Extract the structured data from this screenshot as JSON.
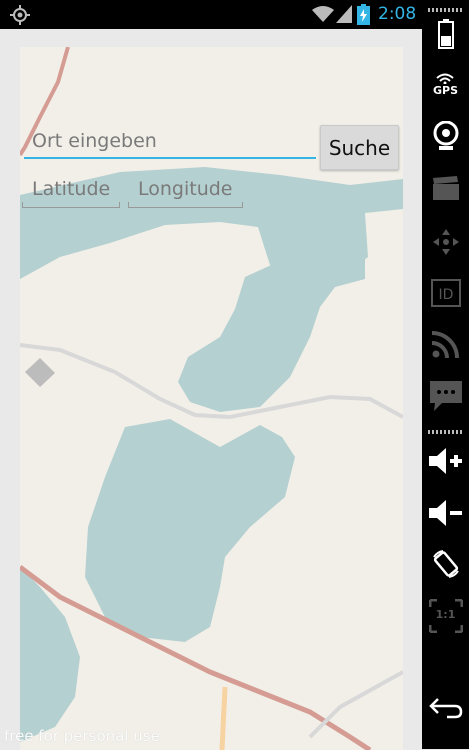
{
  "status_bar": {
    "time": "2:08",
    "icons": [
      "gps-icon",
      "wifi-icon",
      "signal-icon",
      "battery-icon"
    ],
    "time_color": "#33b5e5"
  },
  "search": {
    "placeholder": "Ort eingeben",
    "value": "",
    "button_label": "Suche"
  },
  "coordinates": {
    "latitude_placeholder": "Latitude",
    "longitude_placeholder": "Longitude"
  },
  "map": {
    "water_color": "#b5d0d0",
    "land_color": "#f2efe9",
    "road_color": "#d59c94"
  },
  "watermark": "free for personal use",
  "side_panel": {
    "gps_label": "GPS",
    "zoom_label": "1:1",
    "buttons": [
      "battery-icon",
      "gps-icon",
      "webcam-icon",
      "movie-icon",
      "dpad-icon",
      "id-icon",
      "rss-icon",
      "sms-icon",
      "volume-up-icon",
      "volume-down-icon",
      "rotate-icon",
      "scale-icon",
      "back-icon"
    ]
  },
  "colors": {
    "accent": "#33b5e5",
    "status_bar_bg": "#000000"
  }
}
